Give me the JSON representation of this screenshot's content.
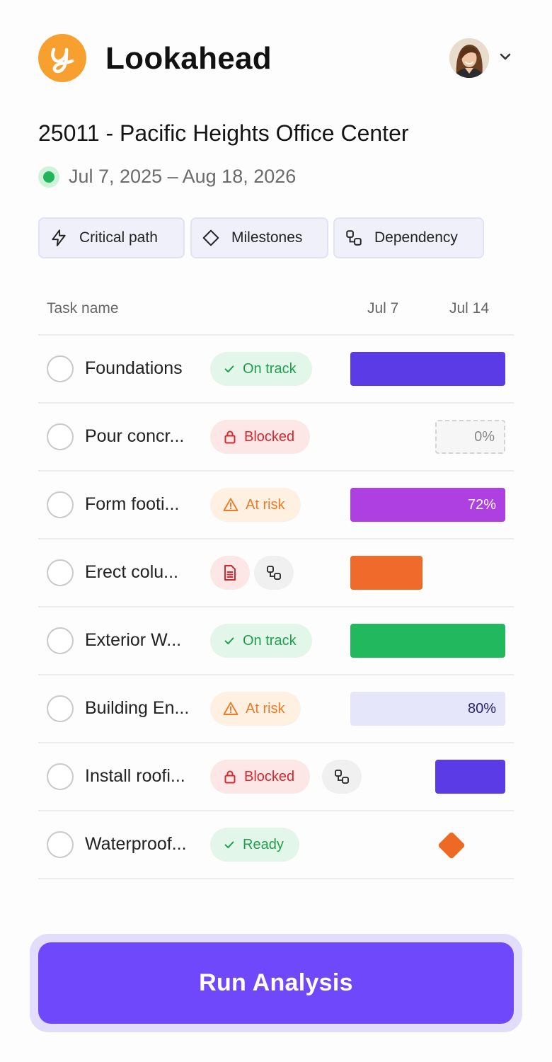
{
  "app": {
    "title": "Lookahead",
    "logo_letter": "y",
    "accent": "#7048fb"
  },
  "project": {
    "title": "25011 - Pacific Heights Office Center",
    "date_range": "Jul 7, 2025 – Aug 18, 2026",
    "status_color": "#22b45a"
  },
  "filters": [
    {
      "label": "Critical path",
      "icon": "lightning-icon"
    },
    {
      "label": "Milestones",
      "icon": "diamond-icon"
    },
    {
      "label": "Dependency",
      "icon": "dependency-icon"
    }
  ],
  "table": {
    "headers": {
      "task": "Task name",
      "week1": "Jul 7",
      "week2": "Jul 14"
    }
  },
  "tasks": [
    {
      "name": "Foundations",
      "status": "On track",
      "status_icon": "check-icon",
      "bar_color": "#5a3be6",
      "progress_label": ""
    },
    {
      "name": "Pour concr...",
      "status": "Blocked",
      "status_icon": "lock-icon",
      "bar_color": "#f6f6f6",
      "progress_label": "0%"
    },
    {
      "name": "Form footi...",
      "status": "At risk",
      "status_icon": "warning-icon",
      "bar_color": "#ae3fe0",
      "progress_label": "72%"
    },
    {
      "name": "Erect colu...",
      "status": "",
      "extra_icons": [
        "document-icon",
        "dependency-icon"
      ],
      "bar_color": "#ef6a2b",
      "progress_label": ""
    },
    {
      "name": "Exterior W...",
      "status": "On track",
      "status_icon": "check-icon",
      "bar_color": "#22b85e",
      "progress_label": ""
    },
    {
      "name": "Building En...",
      "status": "At risk",
      "status_icon": "warning-icon",
      "bar_color": "#e6e6fb",
      "progress_label": "80%"
    },
    {
      "name": "Install roofi...",
      "status": "Blocked",
      "status_icon": "lock-icon",
      "extra_icons": [
        "dependency-icon"
      ],
      "bar_color": "#5a3be6",
      "progress_label": ""
    },
    {
      "name": "Waterproof...",
      "status": "Ready",
      "status_icon": "check-icon",
      "milestone_color": "#ed6a25",
      "progress_label": ""
    }
  ],
  "actions": {
    "run_label": "Run Analysis"
  }
}
